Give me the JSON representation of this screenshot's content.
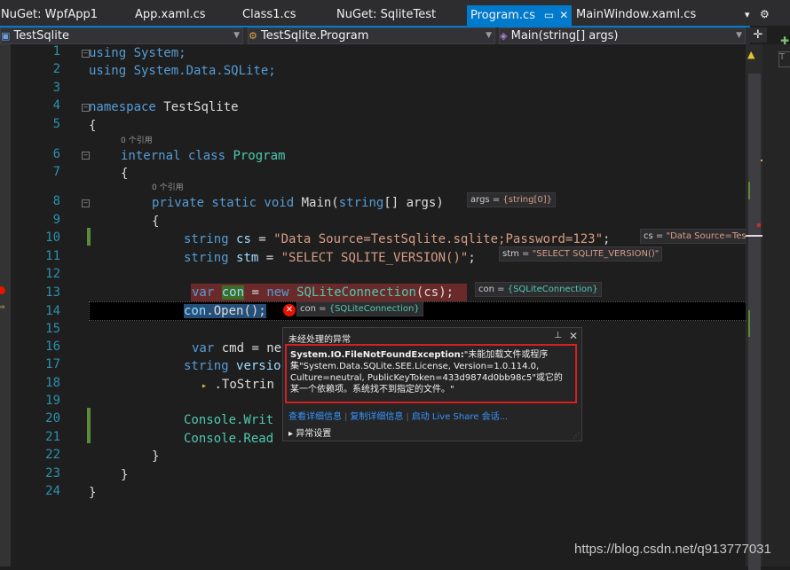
{
  "tabs": [
    {
      "label": "NuGet: WpfApp1"
    },
    {
      "label": "App.xaml.cs"
    },
    {
      "label": "Class1.cs"
    },
    {
      "label": "NuGet: SqliteTest"
    },
    {
      "label": "Program.cs",
      "active": true
    },
    {
      "label": "MainWindow.xaml.cs"
    }
  ],
  "navbar": {
    "project": "TestSqlite",
    "class": "TestSqlite.Program",
    "member": "Main(string[] args)"
  },
  "code": {
    "line_numbers": [
      "1",
      "2",
      "3",
      "4",
      "5",
      "6",
      "7",
      "8",
      "9",
      "10",
      "11",
      "12",
      "13",
      "14",
      "15",
      "16",
      "17",
      "18",
      "19",
      "20",
      "21",
      "22",
      "23",
      "24"
    ],
    "l1": "using System;",
    "l2": "using System.Data.SQLite;",
    "l4_kw": "namespace",
    "l4_name": "TestSqlite",
    "l5": "{",
    "ref_class": "0 个引用",
    "l6_kw": "internal class",
    "l6_name": "Program",
    "l7": "{",
    "ref_main": "0 个引用",
    "l8_kw": "private static void",
    "l8_rest": "Main(",
    "l8_type": "string",
    "l8_args": "[] args)",
    "l9": "{",
    "l10_kw": "string",
    "l10_var": "cs",
    "l10_eq": " = ",
    "l10_str": "\"Data Source=TestSqlite.sqlite;Password=123\"",
    "l10_end": ";",
    "l11_kw": "string",
    "l11_var": "stm",
    "l11_eq": " = ",
    "l11_str": "\"SELECT SQLITE_VERSION()\"",
    "l11_end": ";",
    "l13_kw": "var",
    "l13_var": "con",
    "l13_eq": " = ",
    "l13_new": "new",
    "l13_type": "SQLiteConnection",
    "l13_rest": "(cs);",
    "l14_var": "con",
    "l14_rest": ".Open();",
    "l16_kw": "var",
    "l16_rest": "cmd = ne",
    "l17_kw": "string",
    "l17_rest": "versio",
    "l18_rest": ".ToStrin",
    "l20": "Console.Writ",
    "l21": "Console.Read",
    "l22": "}",
    "l23": "}",
    "l24": "}"
  },
  "datatips": {
    "args": {
      "name": "args",
      "value": "{string[0]}"
    },
    "cs": {
      "name": "cs",
      "value": "\"Data Source=Test"
    },
    "stm": {
      "name": "stm",
      "value": "\"SELECT SQLITE_VERSION()\""
    },
    "con13": {
      "name": "con",
      "value": "{SQLiteConnection}"
    },
    "con14": {
      "name": "con",
      "value": "{SQLiteConnection}"
    }
  },
  "exception": {
    "title": "未经处理的异常",
    "type": "System.IO.FileNotFoundException:",
    "message": "\"未能加载文件或程序集\"System.Data.SQLite.SEE.License, Version=1.0.114.0, Culture=neutral, PublicKeyToken=433d9874d0bb98c5\"或它的某一个依赖项。系统找不到指定的文件。\"",
    "links": [
      "查看详细信息",
      "复制详细信息",
      "启动 Live Share 会话..."
    ],
    "settings": "异常设置"
  },
  "watermark": "https://blog.csdn.net/q913777031",
  "colors": {
    "accent": "#007acc",
    "error": "#d42020",
    "highlight_line": "#6b2a2a"
  }
}
